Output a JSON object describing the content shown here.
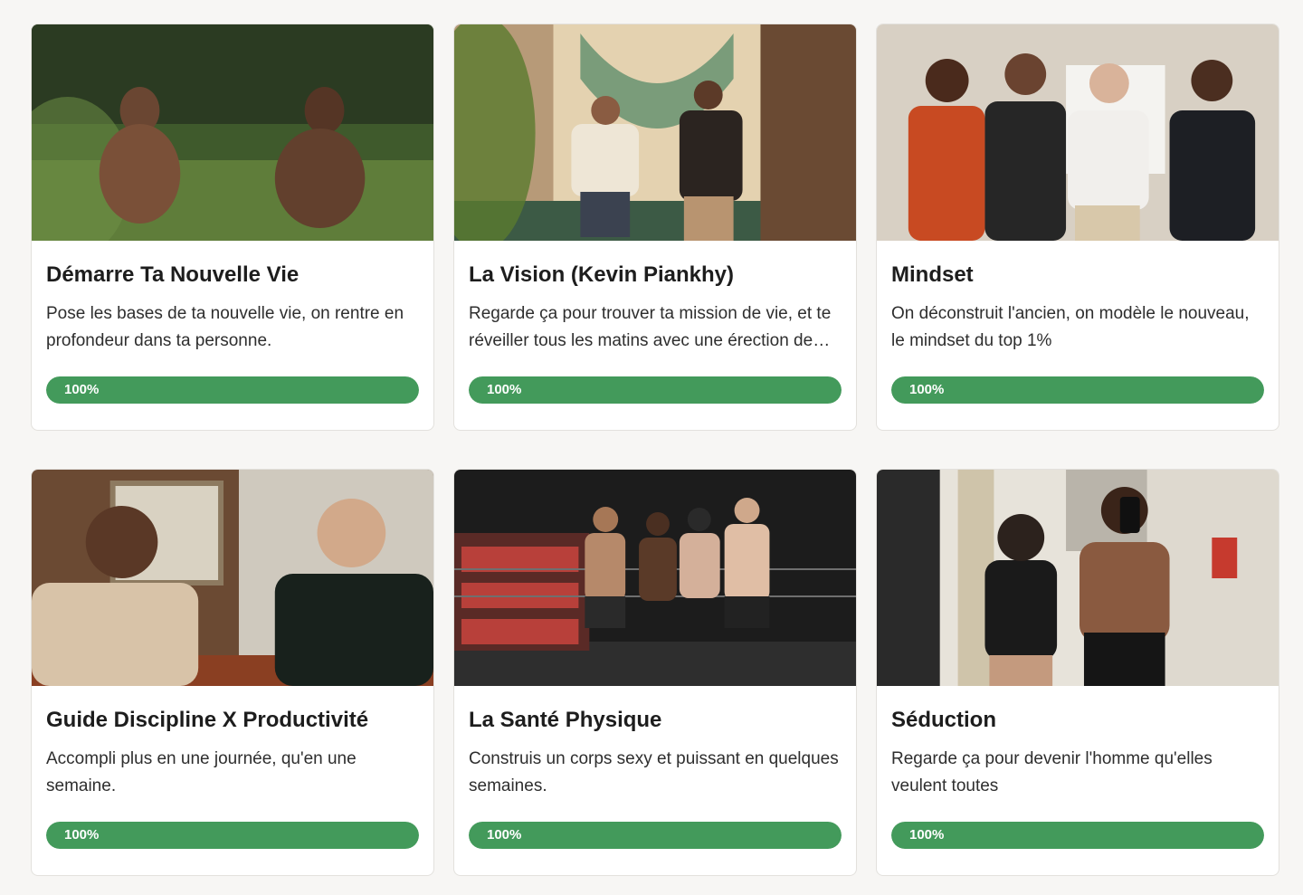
{
  "accent_color": "#439a5b",
  "courses": [
    {
      "title": "Démarre Ta Nouvelle Vie",
      "description": "Pose les bases de ta nouvelle vie, on rentre en profondeur dans ta personne.",
      "progress": 1.0,
      "progress_label": "100%",
      "image": "two-men-crouching-outdoors-photo"
    },
    {
      "title": "La Vision (Kevin Piankhy)",
      "description": "Regarde ça pour trouver ta mission de vie, et te réveiller tous les matins avec une érection de motivation.",
      "progress": 1.0,
      "progress_label": "100%",
      "image": "two-men-by-fountain-photo"
    },
    {
      "title": "Mindset",
      "description": "On déconstruit l'ancien, on modèle le nouveau, le mindset du top 1%",
      "progress": 1.0,
      "progress_label": "100%",
      "image": "four-men-group-photo"
    },
    {
      "title": "Guide Discipline X Productivité",
      "description": "Accompli plus en une journée, qu'en une semaine.",
      "progress": 1.0,
      "progress_label": "100%",
      "image": "two-men-talking-photo"
    },
    {
      "title": "La Santé Physique",
      "description": "Construis un corps sexy et puissant en quelques semaines.",
      "progress": 1.0,
      "progress_label": "100%",
      "image": "four-men-boxing-gym-photo"
    },
    {
      "title": "Séduction",
      "description": "Regarde ça pour devenir l'homme qu'elles veulent toutes",
      "progress": 1.0,
      "progress_label": "100%",
      "image": "couple-gym-mirror-selfie-photo"
    }
  ]
}
